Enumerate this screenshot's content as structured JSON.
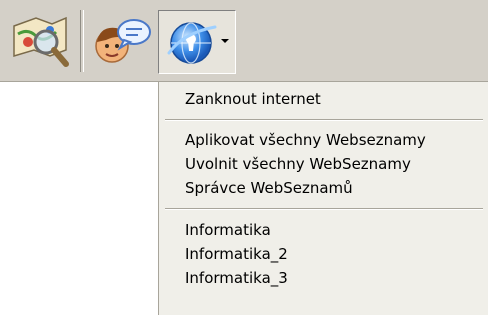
{
  "toolbar": {
    "buttons": [
      {
        "name": "search-tool",
        "icon": "magnifier-map-icon"
      },
      {
        "name": "chat-tool",
        "icon": "person-speech-bubble-icon"
      },
      {
        "name": "internet-lock-tool",
        "icon": "globe-lock-icon",
        "has_dropdown": true,
        "pressed": true
      }
    ]
  },
  "menu": {
    "lock_internet": "Zanknout internet",
    "apply_all": "Aplikovat všechny Webseznamy",
    "release_all": "Uvolnit všechny WebSeznamy",
    "manager": "Správce WebSeznamů",
    "lists": [
      "Informatika",
      "Informatika_2",
      "Informatika_3"
    ]
  },
  "colors": {
    "toolbar_bg": "#d4d0c8",
    "menu_bg": "#f0efe9",
    "globe_blue": "#2b7ad8"
  }
}
